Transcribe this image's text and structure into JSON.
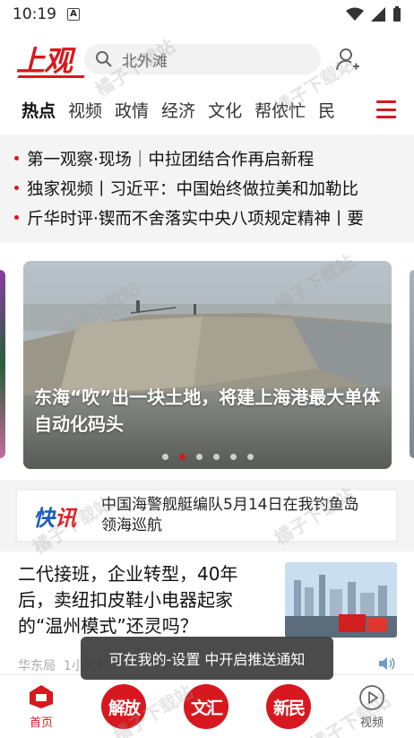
{
  "status_bar": {
    "time": "10:19",
    "notification_badge": "A"
  },
  "header": {
    "logo": "上观",
    "search_placeholder": "北外滩"
  },
  "tabs": [
    "热点",
    "视频",
    "政情",
    "经济",
    "文化",
    "帮侬忙",
    "民"
  ],
  "headlines": [
    "第一观察·现场｜中拉团结合作再启新程",
    "独家视频丨习近平：中国始终做拉美和加勒比",
    "斤华时评·锲而不舍落实中央八项规定精神丨要"
  ],
  "carousel": {
    "caption": "东海“吹”出一块土地，将建上海港最大单体自动化码头",
    "dot_count": 6,
    "active_index": 1
  },
  "flash_news": {
    "logo_a": "快",
    "logo_b": "讯",
    "text": "中国海警舰艇编队5月14日在我钓鱼岛领海巡航"
  },
  "article": {
    "title": "二代接班，企业转型，40年后，卖纽扣皮鞋小电器起家的“温州模式”还灵吗？",
    "source": "华东局",
    "time": "1小时前"
  },
  "toast": "可在我的-设置 中开启推送通知",
  "bottom_nav": {
    "home_label": "首页",
    "paper1": "解放",
    "paper2": "文汇",
    "paper3": "新民",
    "video_label": "视频"
  },
  "watermark": "橘子下载站",
  "colors": {
    "accent": "#d7181f",
    "flash_blue": "#1b5cb8"
  }
}
